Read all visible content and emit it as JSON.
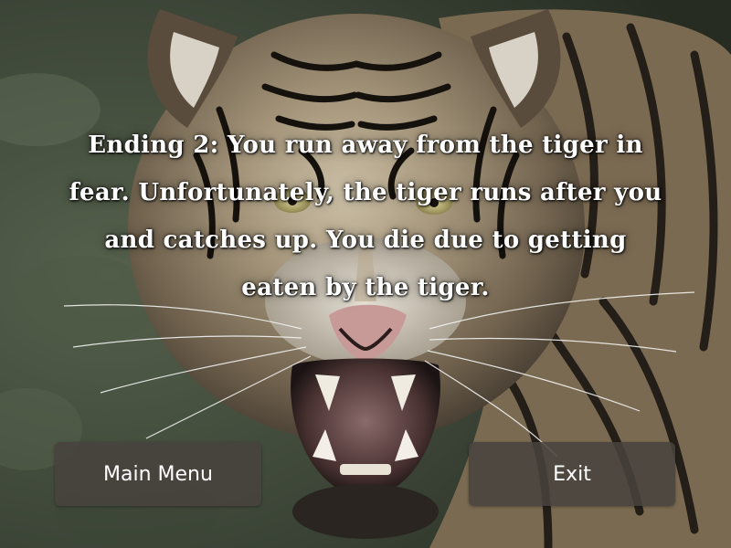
{
  "story": {
    "ending_text": "Ending 2: You run away from the tiger in fear. Unfortunately, the tiger runs after you and catches up. You die due to getting eaten by the tiger."
  },
  "buttons": {
    "main_menu_label": "Main Menu",
    "exit_label": "Exit"
  },
  "background": {
    "subject": "snarling-tiger-photo"
  },
  "colors": {
    "button_bg": "#48423e",
    "text": "#ffffff"
  }
}
